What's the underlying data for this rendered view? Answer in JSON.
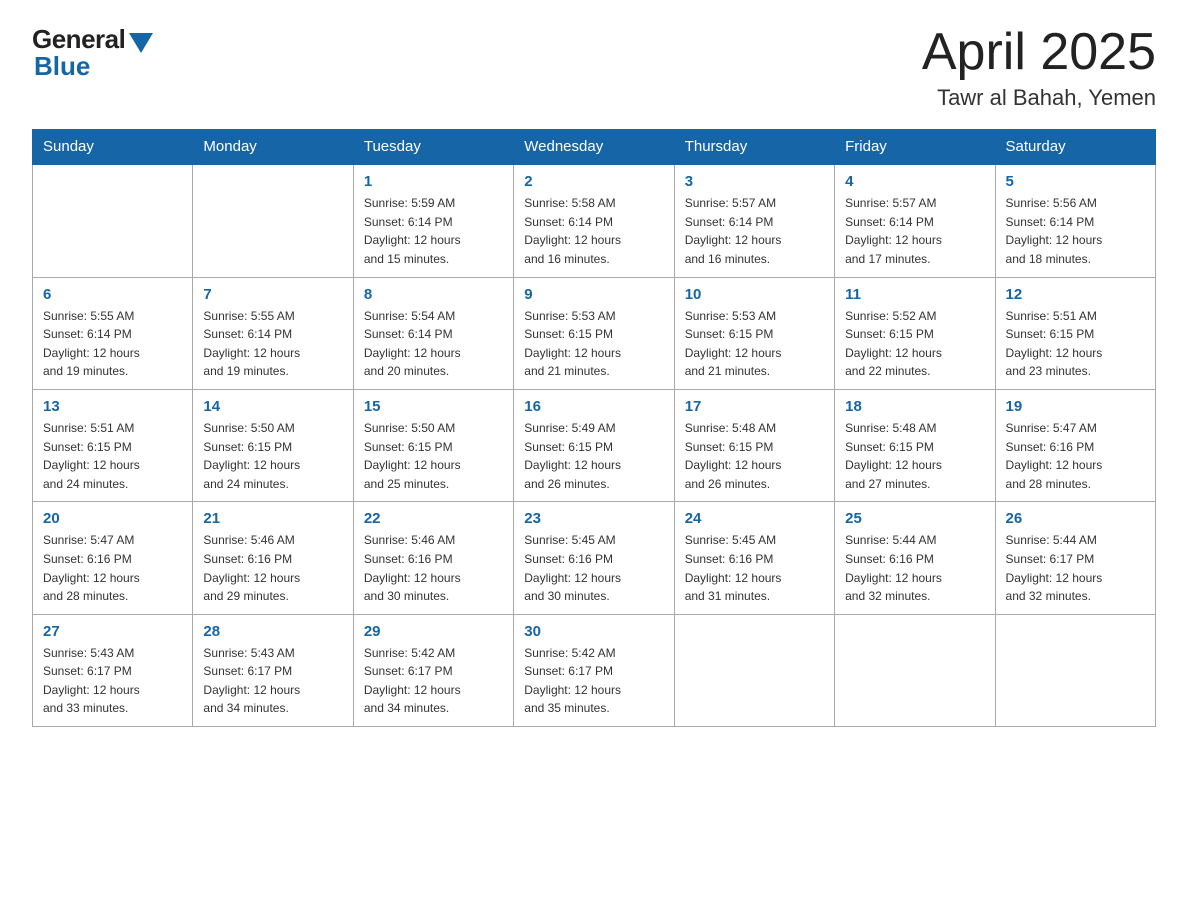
{
  "logo": {
    "general": "General",
    "blue": "Blue"
  },
  "title": "April 2025",
  "subtitle": "Tawr al Bahah, Yemen",
  "days_of_week": [
    "Sunday",
    "Monday",
    "Tuesday",
    "Wednesday",
    "Thursday",
    "Friday",
    "Saturday"
  ],
  "weeks": [
    [
      {
        "day": "",
        "info": ""
      },
      {
        "day": "",
        "info": ""
      },
      {
        "day": "1",
        "info": "Sunrise: 5:59 AM\nSunset: 6:14 PM\nDaylight: 12 hours\nand 15 minutes."
      },
      {
        "day": "2",
        "info": "Sunrise: 5:58 AM\nSunset: 6:14 PM\nDaylight: 12 hours\nand 16 minutes."
      },
      {
        "day": "3",
        "info": "Sunrise: 5:57 AM\nSunset: 6:14 PM\nDaylight: 12 hours\nand 16 minutes."
      },
      {
        "day": "4",
        "info": "Sunrise: 5:57 AM\nSunset: 6:14 PM\nDaylight: 12 hours\nand 17 minutes."
      },
      {
        "day": "5",
        "info": "Sunrise: 5:56 AM\nSunset: 6:14 PM\nDaylight: 12 hours\nand 18 minutes."
      }
    ],
    [
      {
        "day": "6",
        "info": "Sunrise: 5:55 AM\nSunset: 6:14 PM\nDaylight: 12 hours\nand 19 minutes."
      },
      {
        "day": "7",
        "info": "Sunrise: 5:55 AM\nSunset: 6:14 PM\nDaylight: 12 hours\nand 19 minutes."
      },
      {
        "day": "8",
        "info": "Sunrise: 5:54 AM\nSunset: 6:14 PM\nDaylight: 12 hours\nand 20 minutes."
      },
      {
        "day": "9",
        "info": "Sunrise: 5:53 AM\nSunset: 6:15 PM\nDaylight: 12 hours\nand 21 minutes."
      },
      {
        "day": "10",
        "info": "Sunrise: 5:53 AM\nSunset: 6:15 PM\nDaylight: 12 hours\nand 21 minutes."
      },
      {
        "day": "11",
        "info": "Sunrise: 5:52 AM\nSunset: 6:15 PM\nDaylight: 12 hours\nand 22 minutes."
      },
      {
        "day": "12",
        "info": "Sunrise: 5:51 AM\nSunset: 6:15 PM\nDaylight: 12 hours\nand 23 minutes."
      }
    ],
    [
      {
        "day": "13",
        "info": "Sunrise: 5:51 AM\nSunset: 6:15 PM\nDaylight: 12 hours\nand 24 minutes."
      },
      {
        "day": "14",
        "info": "Sunrise: 5:50 AM\nSunset: 6:15 PM\nDaylight: 12 hours\nand 24 minutes."
      },
      {
        "day": "15",
        "info": "Sunrise: 5:50 AM\nSunset: 6:15 PM\nDaylight: 12 hours\nand 25 minutes."
      },
      {
        "day": "16",
        "info": "Sunrise: 5:49 AM\nSunset: 6:15 PM\nDaylight: 12 hours\nand 26 minutes."
      },
      {
        "day": "17",
        "info": "Sunrise: 5:48 AM\nSunset: 6:15 PM\nDaylight: 12 hours\nand 26 minutes."
      },
      {
        "day": "18",
        "info": "Sunrise: 5:48 AM\nSunset: 6:15 PM\nDaylight: 12 hours\nand 27 minutes."
      },
      {
        "day": "19",
        "info": "Sunrise: 5:47 AM\nSunset: 6:16 PM\nDaylight: 12 hours\nand 28 minutes."
      }
    ],
    [
      {
        "day": "20",
        "info": "Sunrise: 5:47 AM\nSunset: 6:16 PM\nDaylight: 12 hours\nand 28 minutes."
      },
      {
        "day": "21",
        "info": "Sunrise: 5:46 AM\nSunset: 6:16 PM\nDaylight: 12 hours\nand 29 minutes."
      },
      {
        "day": "22",
        "info": "Sunrise: 5:46 AM\nSunset: 6:16 PM\nDaylight: 12 hours\nand 30 minutes."
      },
      {
        "day": "23",
        "info": "Sunrise: 5:45 AM\nSunset: 6:16 PM\nDaylight: 12 hours\nand 30 minutes."
      },
      {
        "day": "24",
        "info": "Sunrise: 5:45 AM\nSunset: 6:16 PM\nDaylight: 12 hours\nand 31 minutes."
      },
      {
        "day": "25",
        "info": "Sunrise: 5:44 AM\nSunset: 6:16 PM\nDaylight: 12 hours\nand 32 minutes."
      },
      {
        "day": "26",
        "info": "Sunrise: 5:44 AM\nSunset: 6:17 PM\nDaylight: 12 hours\nand 32 minutes."
      }
    ],
    [
      {
        "day": "27",
        "info": "Sunrise: 5:43 AM\nSunset: 6:17 PM\nDaylight: 12 hours\nand 33 minutes."
      },
      {
        "day": "28",
        "info": "Sunrise: 5:43 AM\nSunset: 6:17 PM\nDaylight: 12 hours\nand 34 minutes."
      },
      {
        "day": "29",
        "info": "Sunrise: 5:42 AM\nSunset: 6:17 PM\nDaylight: 12 hours\nand 34 minutes."
      },
      {
        "day": "30",
        "info": "Sunrise: 5:42 AM\nSunset: 6:17 PM\nDaylight: 12 hours\nand 35 minutes."
      },
      {
        "day": "",
        "info": ""
      },
      {
        "day": "",
        "info": ""
      },
      {
        "day": "",
        "info": ""
      }
    ]
  ]
}
